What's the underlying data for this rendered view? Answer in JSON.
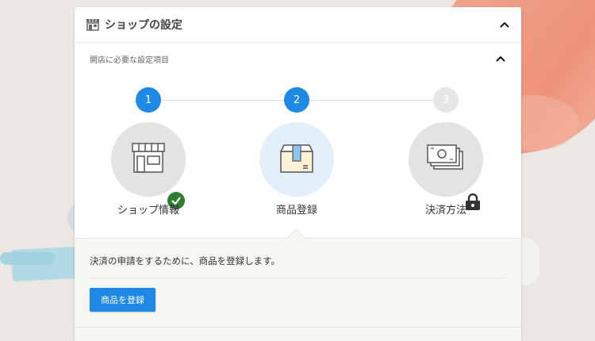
{
  "panel": {
    "title": "ショップの設定",
    "icon": "store-icon",
    "collapse_icon": "chevron-up-icon"
  },
  "section": {
    "title": "開店に必要な設定項目",
    "collapse_icon": "chevron-up-icon"
  },
  "steps": [
    {
      "number": "1",
      "label": "ショップ情報",
      "icon": "shop-storefront-icon",
      "status": "completed",
      "badge": "check-icon"
    },
    {
      "number": "2",
      "label": "商品登録",
      "icon": "product-box-icon",
      "status": "current"
    },
    {
      "number": "3",
      "label": "決済方法",
      "icon": "money-bills-icon",
      "status": "locked",
      "badge": "lock-icon"
    }
  ],
  "info": {
    "message": "決済の申請をするために、商品を登録します。",
    "button_label": "商品を登録"
  },
  "colors": {
    "accent": "#1e88e5",
    "completed_badge": "#2e7d32",
    "step_inactive": "#e6e6e6",
    "current_bg": "#e3f0fb"
  }
}
